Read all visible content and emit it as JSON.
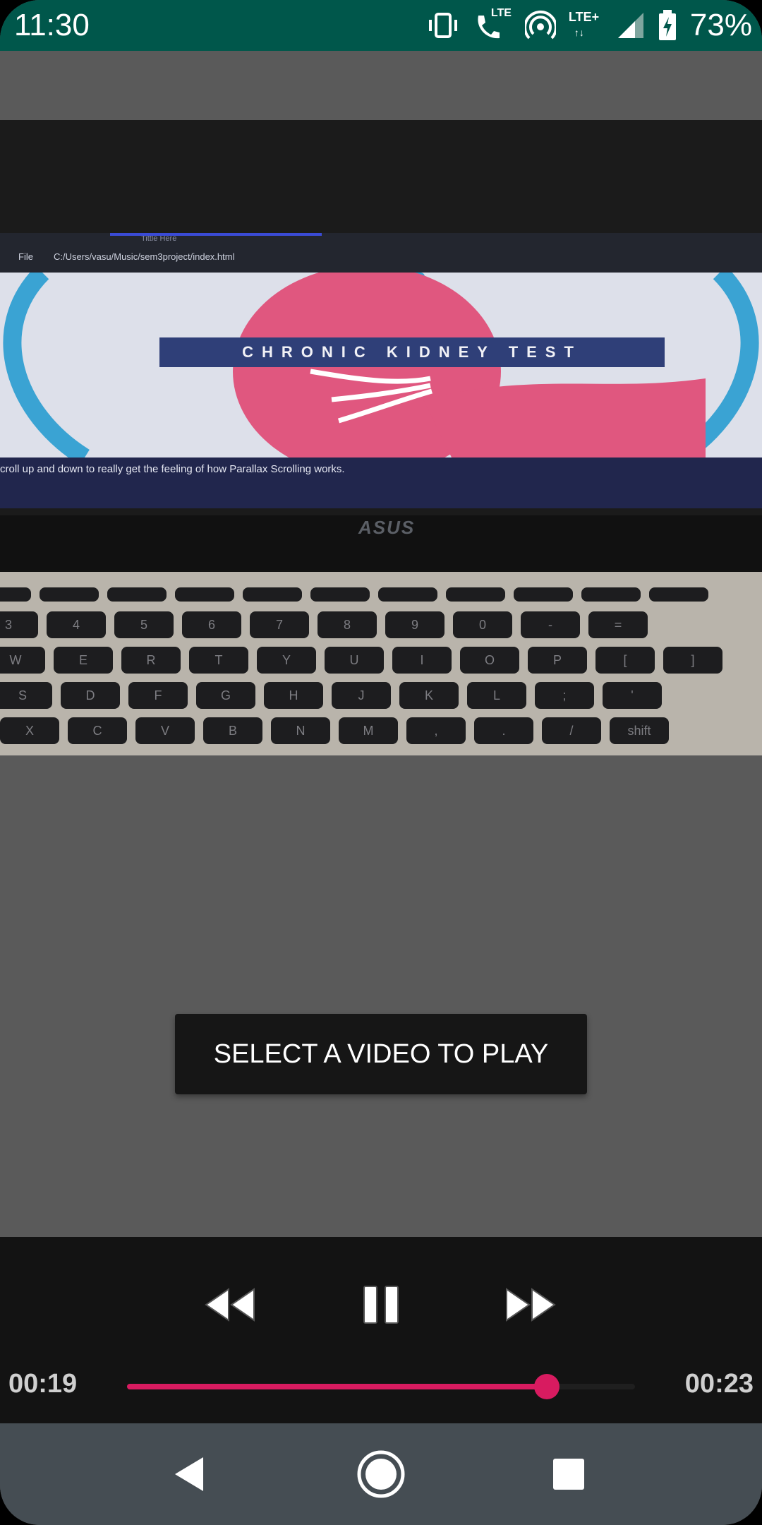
{
  "status_bar": {
    "time": "11:30",
    "battery_percent": "73%",
    "icons": [
      "vibrate-icon",
      "volte-call-icon",
      "hotspot-icon",
      "lte-plus-icon",
      "signal-icon",
      "battery-charging-icon"
    ],
    "lte_label": "LTE",
    "lte_plus_label": "LTE+",
    "color": "#00574b"
  },
  "video": {
    "browser_url": "C:/Users/vasu/Music/sem3project/index.html",
    "file_label": "File",
    "tab_title": "Tittle Here",
    "hero_title": "CHRONIC KIDNEY TEST",
    "hero_caption": "croll up and down to really get the feeling of how Parallax Scrolling works.",
    "laptop_brand": "ASUS",
    "keyboard_rows": [
      [
        "3",
        "4",
        "5",
        "6",
        "7",
        "8",
        "9",
        "0",
        "-",
        "="
      ],
      [
        "W",
        "E",
        "R",
        "T",
        "Y",
        "U",
        "I",
        "O",
        "P",
        "[",
        "]"
      ],
      [
        "S",
        "D",
        "F",
        "G",
        "H",
        "J",
        "K",
        "L",
        ";",
        "'"
      ],
      [
        "X",
        "C",
        "V",
        "B",
        "N",
        "M",
        ",",
        ".",
        "/",
        "shift"
      ]
    ]
  },
  "select_button": {
    "label": "SELECT A VIDEO TO PLAY"
  },
  "player": {
    "current_time": "00:19",
    "total_time": "00:23",
    "progress": 0.826,
    "accent_color": "#d81b60",
    "buttons": [
      "rewind-icon",
      "pause-icon",
      "fast-forward-icon"
    ]
  },
  "nav_bar": {
    "buttons": [
      "back-icon",
      "home-icon",
      "recents-icon"
    ]
  }
}
